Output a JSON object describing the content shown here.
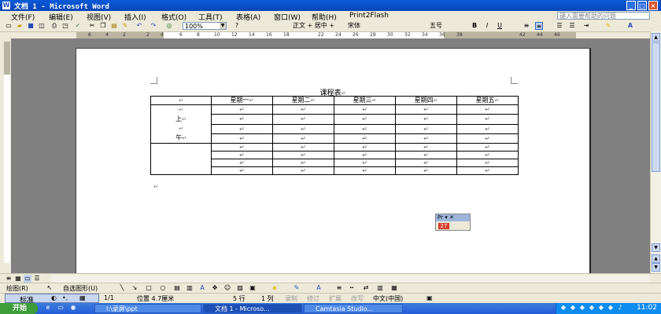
{
  "window": {
    "title": "文档 1 - Microsoft Word"
  },
  "menu": [
    "文件(F)",
    "编辑(E)",
    "视图(V)",
    "插入(I)",
    "格式(O)",
    "工具(T)",
    "表格(A)",
    "窗口(W)",
    "帮助(H)",
    "Print2Flash"
  ],
  "help_placeholder": "键入需要帮助的问题",
  "toolbar": {
    "zoom": "100%",
    "style": "正文 + 居中 +",
    "font": "宋体",
    "size": "五号",
    "bold": "B",
    "italic": "I",
    "underline": "U",
    "fontcolor": "A"
  },
  "ruler_numbers": [
    "6",
    "4",
    "2",
    "2",
    "4",
    "6",
    "8",
    "10",
    "12",
    "14",
    "16",
    "18",
    "22",
    "24",
    "26",
    "28",
    "30",
    "32",
    "34",
    "36",
    "38",
    "42",
    "44",
    "46"
  ],
  "doc": {
    "title": "课程表",
    "header_row": [
      "",
      "星期一",
      "星期二",
      "星期三",
      "星期四",
      "星期五"
    ],
    "morning": [
      "上",
      "午"
    ]
  },
  "floating_toolbar": {
    "title": "Pr",
    "button": "27"
  },
  "drawing": {
    "draw_label": "绘图(R)",
    "autoshape_label": "自选图形(U)"
  },
  "ime": {
    "label": "标准"
  },
  "status": {
    "page": "1/1",
    "position": "位置 4.7厘米",
    "line": "5 行",
    "col": "1 列",
    "rec": "录制",
    "trk": "修订",
    "ext": "扩展",
    "ovr": "改写",
    "lang": "中文(中国)"
  },
  "taskbar": {
    "start": "开始",
    "tasks": [
      "I:\\录屏\\ppt",
      "文档 1 - Microso...",
      "Camtasia Studio..."
    ],
    "clock": "11:02"
  }
}
